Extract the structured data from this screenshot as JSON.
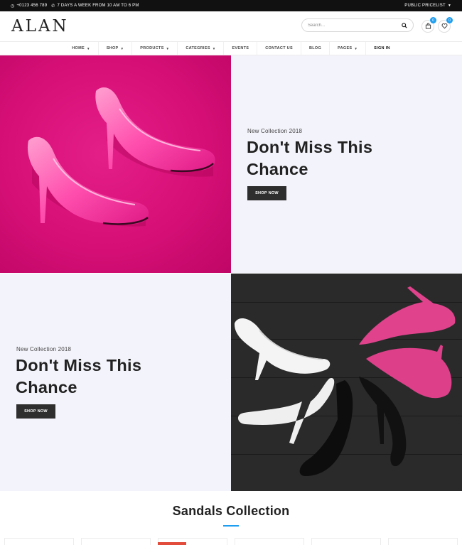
{
  "topbar": {
    "phone": "+0123 456 789",
    "hours": "7 DAYS A WEEK FROM 10 AM TO 6 PM",
    "pricelist": "PUBLIC PRICELIST",
    "clock_icon": "clock-icon",
    "phone_icon": "phone-icon"
  },
  "header": {
    "logo": "ALAN",
    "search_placeholder": "Search...",
    "cart_count": "0",
    "wishlist_count": "0"
  },
  "nav": {
    "items": [
      {
        "label": "HOME",
        "dropdown": true
      },
      {
        "label": "SHOP",
        "dropdown": true
      },
      {
        "label": "PRODUCTS",
        "dropdown": true
      },
      {
        "label": "CATEGRIES",
        "dropdown": true
      },
      {
        "label": "EVENTS",
        "dropdown": false
      },
      {
        "label": "CONTACT US",
        "dropdown": false
      },
      {
        "label": "BLOG",
        "dropdown": false
      },
      {
        "label": "PAGES",
        "dropdown": true
      },
      {
        "label": "SIGN IN",
        "dropdown": false
      }
    ]
  },
  "banners": [
    {
      "eyebrow": "New Collection 2018",
      "headline_line1": "Don't Miss This",
      "headline_line2": "Chance",
      "button": "SHOP NOW"
    },
    {
      "eyebrow": "New Collection 2018",
      "headline_line1": "Don't Miss This",
      "headline_line2": "Chance",
      "button": "SHOP NOW"
    }
  ],
  "collection": {
    "title": "Sandals Collection"
  },
  "colors": {
    "accent": "#1e9ef0",
    "pink_banner": "#d60f76",
    "dark_banner": "#2a2a2b",
    "banner_text_bg": "#f3f3fb",
    "button": "#2e2e2e"
  }
}
